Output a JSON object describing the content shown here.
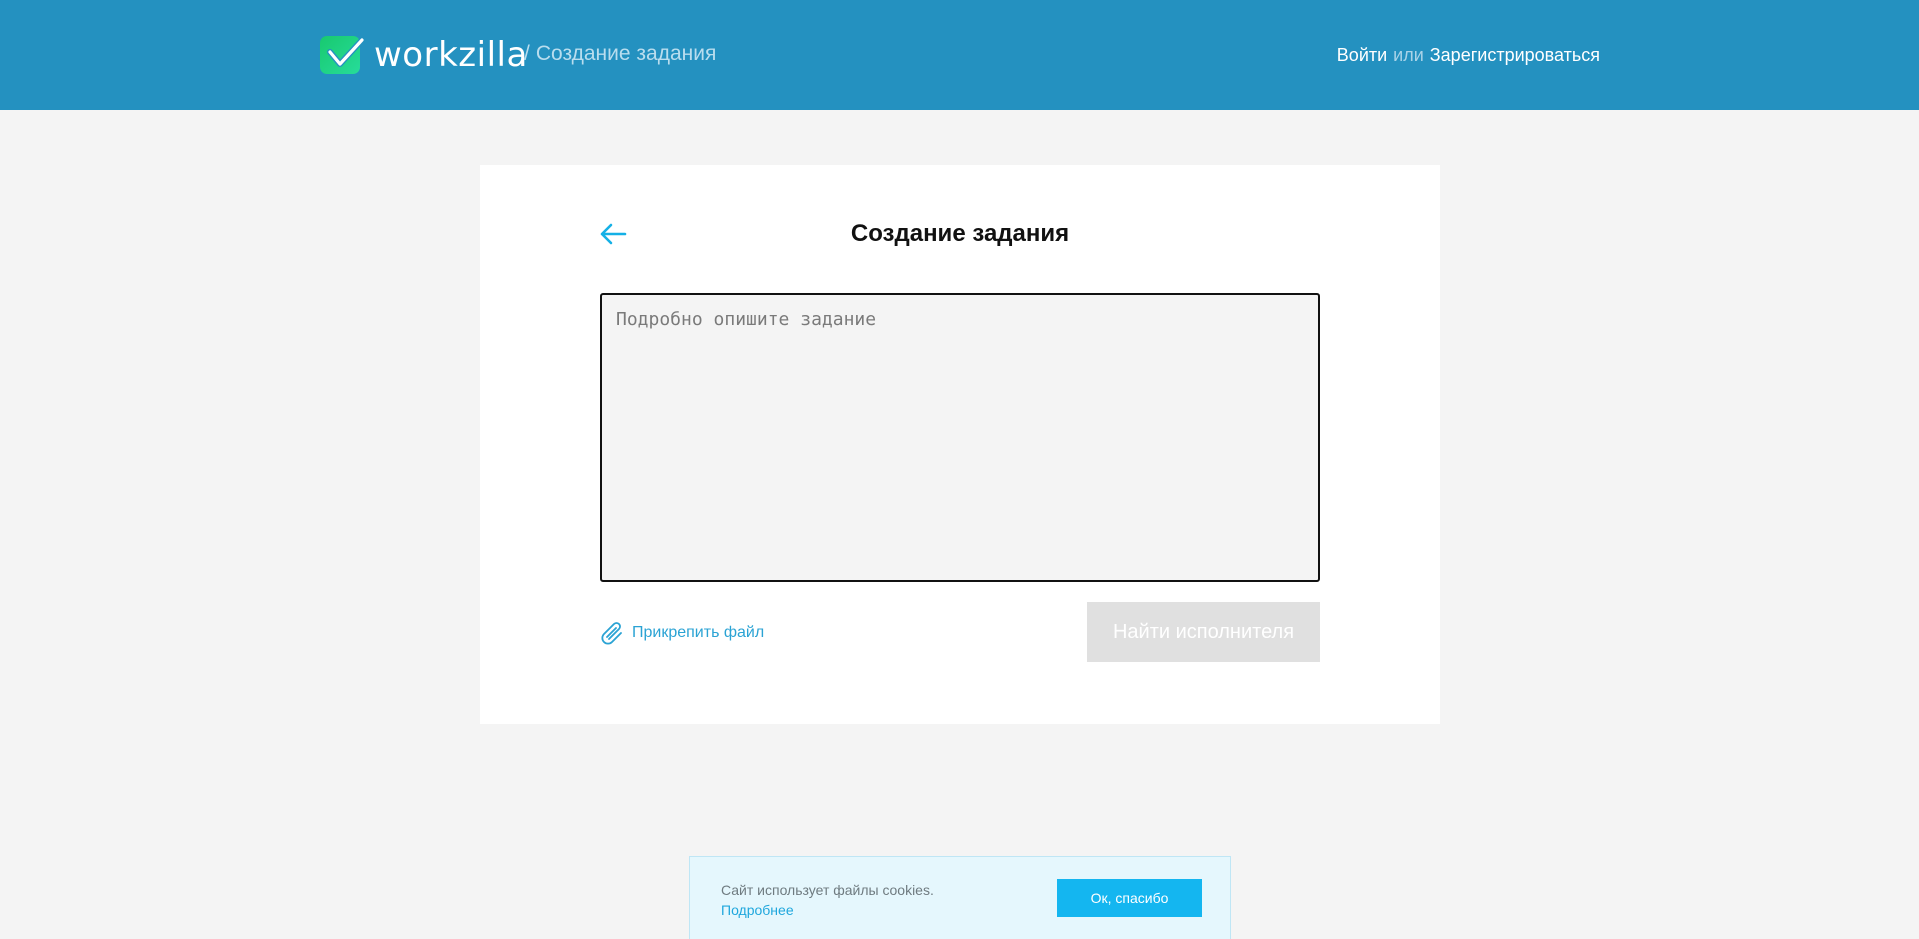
{
  "header": {
    "logo_text": "workzilla",
    "breadcrumb_sep": "/",
    "breadcrumb_current": "Создание задания",
    "login_label": "Войти",
    "or_label": "или",
    "register_label": "Зарегистрироваться"
  },
  "task_form": {
    "title": "Создание задания",
    "description_placeholder": "Подробно опишите задание",
    "attach_label": "Прикрепить файл",
    "submit_label": "Найти исполнителя",
    "submit_enabled": false
  },
  "cookie_banner": {
    "message": "Сайт использует файлы cookies.",
    "more_label": "Подробнее",
    "ok_label": "Ок, спасибо"
  },
  "icons": {
    "logo": "workzilla-check-logo-icon",
    "back": "arrow-left-icon",
    "attach": "paperclip-icon"
  },
  "colors": {
    "header_bg": "#2491c0",
    "accent": "#14b6f0",
    "logo_green": "#1fd07a",
    "disabled_button": "#e0e0e0",
    "page_bg": "#f4f4f4"
  }
}
